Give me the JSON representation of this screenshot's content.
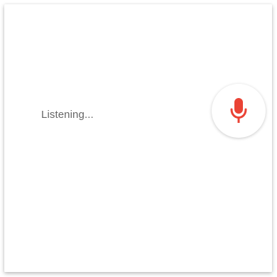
{
  "status": {
    "text": "Listening..."
  },
  "mic_button": {
    "icon": "microphone-icon",
    "color": "#ea4335"
  },
  "colors": {
    "background": "#ffffff",
    "text": "#666666",
    "accent": "#ea4335"
  }
}
